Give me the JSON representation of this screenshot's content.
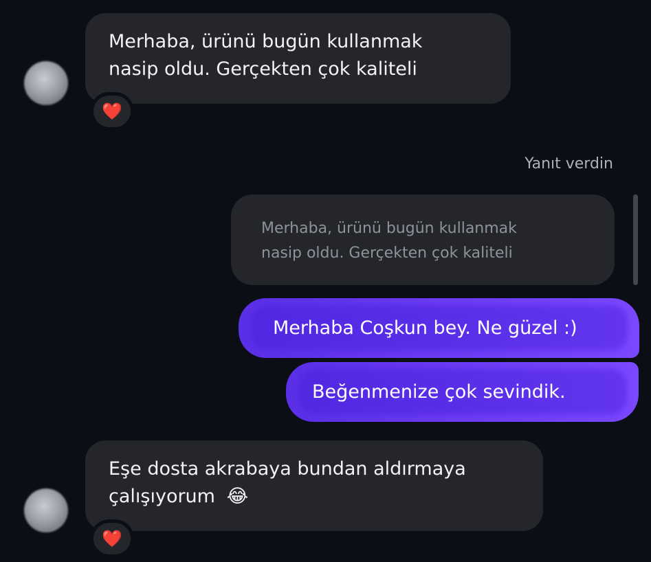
{
  "messages": {
    "first": {
      "text_line1": "Merhaba, ürünü bugün kullanmak",
      "text_line2": "nasip oldu. Gerçekten çok kaliteli",
      "reaction": "❤️"
    },
    "reply": {
      "meta": "Yanıt verdin",
      "quoted_line1": "Merhaba, ürünü bugün kullanmak",
      "quoted_line2": "nasip oldu. Gerçekten çok kaliteli",
      "sent_1": "Merhaba Coşkun bey. Ne güzel :)",
      "sent_2": "Beğenmenize çok sevindik."
    },
    "second": {
      "text_line1": "Eşe dosta akrabaya bundan aldırmaya",
      "text_line2": "çalışıyorum",
      "emoji": "😂",
      "reaction": "❤️"
    }
  },
  "colors": {
    "background": "#0b0e14",
    "incoming_bubble": "#25262b",
    "outgoing_bubble": "#6d3ef5",
    "reaction_heart": "#ff2d3a"
  },
  "icons": {
    "avatar": "blurred-avatar",
    "reaction": "heart-icon",
    "emoji": "tears-of-joy-emoji"
  }
}
